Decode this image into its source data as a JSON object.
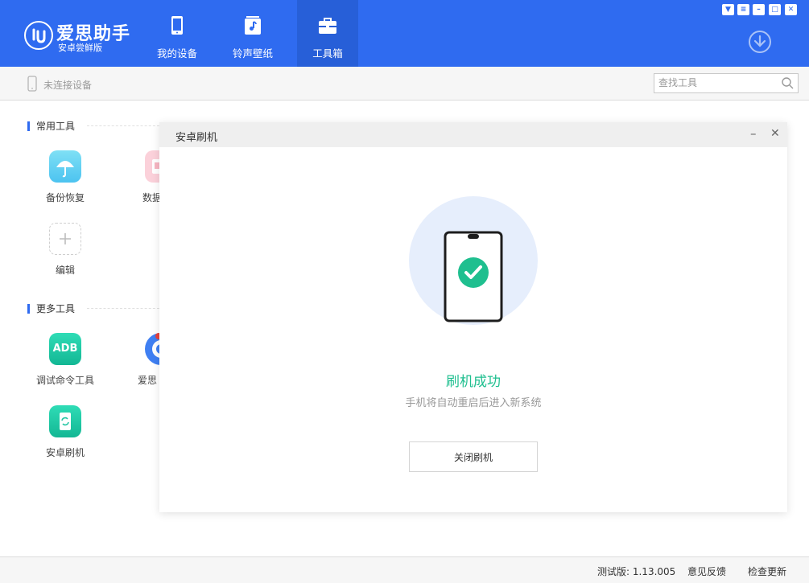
{
  "app": {
    "brand_name": "爱思助手",
    "brand_subtitle": "安卓尝鲜版"
  },
  "nav": {
    "items": [
      {
        "label": "我的设备",
        "icon": "phone-icon"
      },
      {
        "label": "铃声壁纸",
        "icon": "music-icon"
      },
      {
        "label": "工具箱",
        "icon": "toolbox-icon",
        "active": true
      }
    ]
  },
  "window_controls": [
    "shirt-icon",
    "menu-icon",
    "minimize-icon",
    "maximize-icon",
    "close-icon"
  ],
  "subbar": {
    "device_status": "未连接设备",
    "search_placeholder": "查找工具"
  },
  "sections": {
    "common": {
      "title": "常用工具",
      "tools": [
        {
          "label": "备份恢复",
          "icon": "umbrella-icon",
          "color": "#4cc3f0"
        },
        {
          "label": "数据",
          "icon": "data-icon",
          "color": "#f7b7c3"
        },
        {
          "label": "编辑",
          "icon": "plus-icon"
        }
      ]
    },
    "more": {
      "title": "更多工具",
      "tools": [
        {
          "label": "调试命令工具",
          "icon": "adb-icon",
          "icon_text": "ADB",
          "color": "#1ec4a0"
        },
        {
          "label": "爱思",
          "icon": "aisi-icon",
          "color": "#3f7ff2"
        },
        {
          "label": "安卓刷机",
          "icon": "flash-icon",
          "color": "#1ec4a0"
        }
      ]
    }
  },
  "dialog": {
    "title": "安卓刷机",
    "success_title": "刷机成功",
    "success_desc": "手机将自动重启后进入新系统",
    "close_button": "关闭刷机"
  },
  "footer": {
    "version": "测试版: 1.13.005",
    "feedback": "意见反馈",
    "update": "检查更新"
  },
  "colors": {
    "primary": "#2f6bf0",
    "success": "#1fbf8f",
    "accent_green": "#1ec4a0"
  }
}
